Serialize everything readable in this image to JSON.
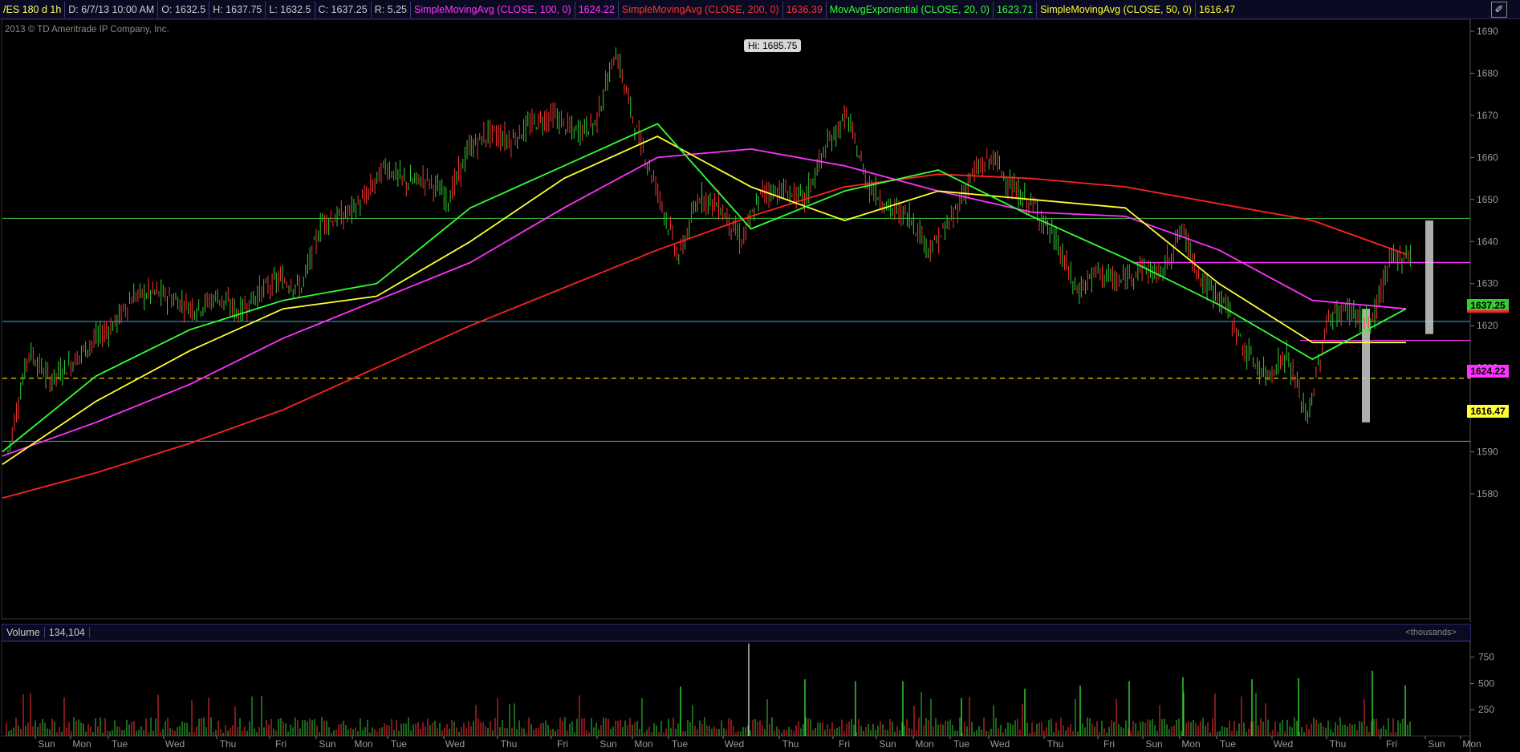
{
  "header": {
    "symbol": "/ES 180 d 1h",
    "date": "D: 6/7/13 10:00 AM",
    "open": "O: 1632.5",
    "high": "H: 1637.75",
    "low": "L: 1632.5",
    "close": "C: 1637.25",
    "range": "R: 5.25",
    "sma100_label": "SimpleMovingAvg (CLOSE, 100, 0)",
    "sma100_value": "1624.22",
    "sma200_label": "SimpleMovingAvg (CLOSE, 200, 0)",
    "sma200_value": "1636.39",
    "ema20_label": "MovAvgExponential (CLOSE, 20, 0)",
    "ema20_value": "1623.71",
    "sma50_label": "SimpleMovingAvg (CLOSE, 50, 0)",
    "sma50_value": "1616.47"
  },
  "copyright": "2013 © TD Ameritrade IP Company, Inc.",
  "hi_label": "Hi: 1685.75",
  "price_tags": {
    "last": "1637.25",
    "sma100": "1624.22",
    "sma50": "1616.47"
  },
  "volume_header": {
    "label": "Volume",
    "value": "134,104",
    "units": "<thousands>"
  },
  "colors": {
    "sma100": "#ff33ff",
    "sma200": "#ff2222",
    "ema20": "#33ff33",
    "sma50": "#ffff33",
    "up": "#33cc33",
    "down": "#ff3333",
    "hline_green": "#33aa33",
    "hline_blue": "#3399cc",
    "hline_dashed": "#ccaa00",
    "hline_magenta": "#ff33ff"
  },
  "chart_data": {
    "type": "line",
    "instrument": "/ES",
    "y_axis": {
      "ticks": [
        1690,
        1680,
        1670,
        1660,
        1650,
        1640,
        1630,
        1620,
        1610,
        1600,
        1590,
        1580
      ],
      "ylim": [
        1575,
        1694
      ]
    },
    "x_tick_labels": [
      "Sun",
      "Mon",
      "Tue",
      "Wed",
      "Thu",
      "Fri",
      "Sun",
      "Mon",
      "Tue",
      "Wed",
      "Thu",
      "Fri",
      "Sun",
      "Mon",
      "Tue",
      "Wed",
      "Thu",
      "Fri",
      "Sun",
      "Mon",
      "Tue",
      "Wed",
      "Thu",
      "Fri",
      "Sun",
      "Mon",
      "Tue",
      "Wed",
      "Thu",
      "Fri",
      "Sun",
      "Mon"
    ],
    "price_path": [
      1590,
      1614,
      1607,
      1611,
      1616,
      1620,
      1627,
      1628,
      1626,
      1624,
      1627,
      1623,
      1628,
      1631,
      1629,
      1645,
      1646,
      1650,
      1658,
      1654,
      1655,
      1650,
      1662,
      1666,
      1664,
      1668,
      1670,
      1666,
      1668,
      1685,
      1666,
      1652,
      1636,
      1651,
      1648,
      1640,
      1652,
      1652,
      1650,
      1662,
      1670,
      1654,
      1648,
      1646,
      1638,
      1645,
      1656,
      1660,
      1652,
      1648,
      1640,
      1628,
      1633,
      1630,
      1634,
      1632,
      1643,
      1630,
      1626,
      1614,
      1608,
      1613,
      1598,
      1622,
      1624,
      1620,
      1636,
      1637
    ],
    "horizontal_levels": {
      "green_solid": 1645.5,
      "blue_upper": 1621,
      "blue_lower": 1592.5,
      "yellow_dashed": 1607.5,
      "magenta_solid": 1635,
      "magenta_short": 1616.5
    },
    "series": [
      {
        "name": "SimpleMovingAvg (CLOSE, 200, 0)",
        "values": [
          1579,
          1585,
          1592,
          1600,
          1610,
          1620,
          1629,
          1638,
          1646,
          1653,
          1656,
          1655,
          1653,
          1649,
          1645,
          1637
        ]
      },
      {
        "name": "SimpleMovingAvg (CLOSE, 100, 0)",
        "values": [
          1589,
          1597,
          1606,
          1617,
          1626,
          1635,
          1648,
          1660,
          1662,
          1658,
          1652,
          1647,
          1646,
          1638,
          1626,
          1624
        ]
      },
      {
        "name": "SimpleMovingAvg (CLOSE, 50, 0)",
        "values": [
          1587,
          1602,
          1614,
          1624,
          1627,
          1640,
          1655,
          1665,
          1653,
          1645,
          1652,
          1650,
          1648,
          1630,
          1616,
          1616
        ]
      },
      {
        "name": "MovAvgExponential (CLOSE, 20, 0)",
        "values": [
          1590,
          1608,
          1619,
          1626,
          1630,
          1648,
          1658,
          1668,
          1643,
          1652,
          1657,
          1646,
          1636,
          1625,
          1612,
          1624
        ]
      }
    ],
    "gray_bars": [
      {
        "from": 1597,
        "to": 1624
      },
      {
        "from": 1618,
        "to": 1645
      }
    ],
    "volume_axis": {
      "ticks": [
        750,
        500,
        250
      ],
      "ylim": [
        0,
        900
      ]
    },
    "volume_spikes": [
      880,
      540,
      470,
      520,
      520,
      360,
      450,
      480,
      520,
      560,
      540,
      550,
      620,
      480
    ]
  }
}
